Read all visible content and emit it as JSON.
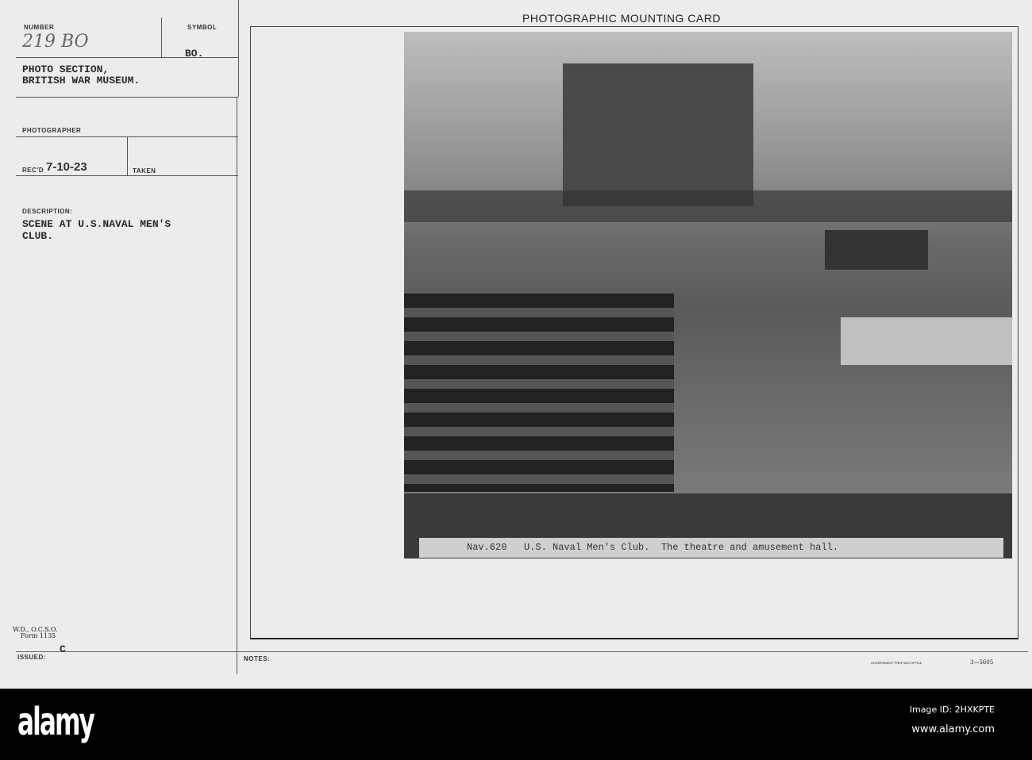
{
  "card": {
    "title": "PHOTOGRAPHIC MOUNTING CARD",
    "number_label": "NUMBER",
    "number_value": "219 BO",
    "symbol_label": "SYMBOL",
    "symbol_value": "BO.",
    "source_line1": "PHOTO SECTION,",
    "source_line2": "BRITISH WAR MUSEUM.",
    "photographer_label": "PHOTOGRAPHER",
    "recd_label": "REC'D",
    "recd_value": "7-10-23",
    "taken_label": "TAKEN",
    "description_label": "DESCRIPTION:",
    "description_line1": "SCENE AT U.S.NAVAL MEN'S",
    "description_line2": "CLUB.",
    "form_line1": "W.D., O.C.S.O.",
    "form_line2": "Form 1135",
    "issued_label": "ISSUED:",
    "issued_value": "C",
    "notes_label": "NOTES:",
    "printer": "GOVERNMENT PRINTING OFFICE",
    "printer_code": "3—5605"
  },
  "photo": {
    "caption": "Nav.620   U.S. Naval Men's Club.  The theatre and amusement hall."
  },
  "watermark": {
    "brand": "alamy",
    "image_id": "Image ID: 2HXKPTE",
    "url": "www.alamy.com"
  }
}
